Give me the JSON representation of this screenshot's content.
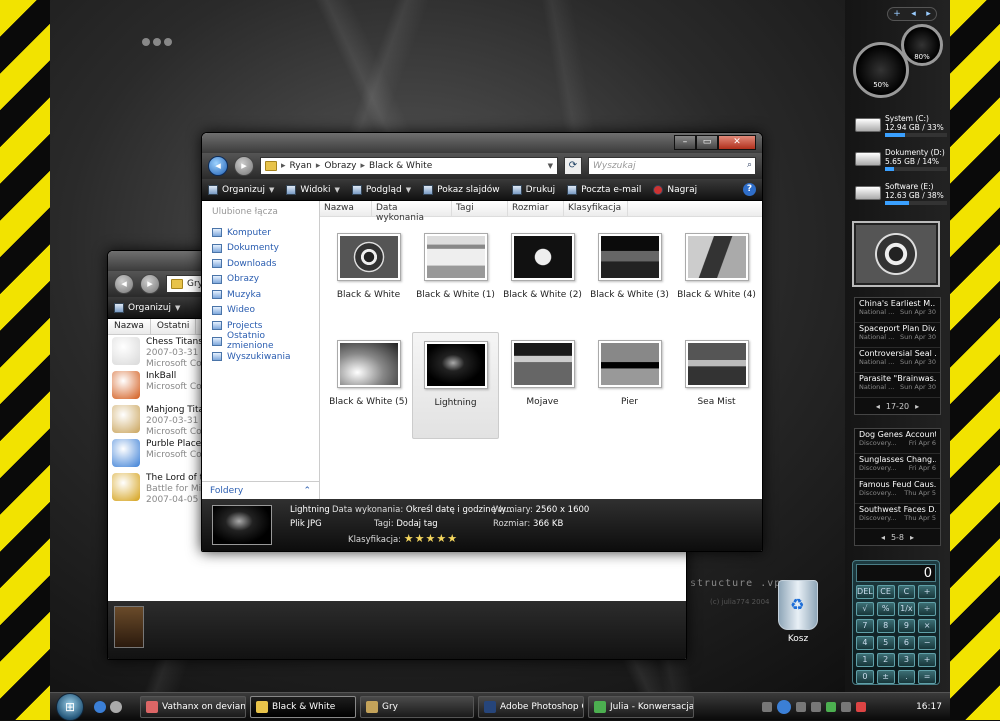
{
  "desktop": {
    "wallpaper_text": "structure .vps",
    "wallpaper_subtext": "(c) julia774 2004",
    "recycle_bin_label": "Kosz"
  },
  "front_window": {
    "title": "Black & White",
    "breadcrumb": [
      "Ryan",
      "Obrazy",
      "Black & White"
    ],
    "search_placeholder": "Wyszukaj",
    "toolbar": {
      "organize": "Organizuj",
      "views": "Widoki",
      "preview": "Podgląd",
      "slideshow": "Pokaz slajdów",
      "print": "Drukuj",
      "email": "Poczta e-mail",
      "burn": "Nagraj"
    },
    "nav_title": "Ulubione łącza",
    "nav_links": [
      "Komputer",
      "Dokumenty",
      "Downloads",
      "Obrazy",
      "Muzyka",
      "Wideo",
      "Projects",
      "Ostatnio zmienione",
      "Wyszukiwania"
    ],
    "folders_label": "Foldery",
    "columns": [
      "Nazwa",
      "Data wykonania",
      "Tagi",
      "Rozmiar",
      "Klasyfikacja"
    ],
    "files": [
      {
        "name": "Black & White",
        "art": "p1"
      },
      {
        "name": "Black & White (1)",
        "art": "p2"
      },
      {
        "name": "Black & White (2)",
        "art": "p3"
      },
      {
        "name": "Black & White (3)",
        "art": "p4"
      },
      {
        "name": "Black & White (4)",
        "art": "p5"
      },
      {
        "name": "Black & White (5)",
        "art": "p6"
      },
      {
        "name": "Lightning",
        "art": "p7"
      },
      {
        "name": "Mojave",
        "art": "p8"
      },
      {
        "name": "Pier",
        "art": "p9"
      },
      {
        "name": "Sea Mist",
        "art": "p10"
      }
    ],
    "selected_file": "Lightning",
    "details": {
      "name": "Lightning",
      "type": "Plik JPG",
      "date_label": "Data wykonania:",
      "date_value": "Określ datę i godzinę w...",
      "tags_label": "Tagi:",
      "tags_value": "Dodaj tag",
      "rating_label": "Klasyfikacja:",
      "rating_stars": "★★★★★",
      "dimensions_label": "Wymiary:",
      "dimensions_value": "2560 x 1600",
      "size_label": "Rozmiar:",
      "size_value": "366 KB"
    }
  },
  "back_window": {
    "title_fragment": "Gry",
    "toolbar_organize": "Organizuj",
    "columns": [
      "Nazwa",
      "Ostatni"
    ],
    "games": [
      {
        "line1": "Chess Titans",
        "line2": "2007-03-31 1",
        "line3": "Microsoft Co",
        "icon_color": "#d8d8d8"
      },
      {
        "line1": "InkBall",
        "line2": "Microsoft Co",
        "line3": "",
        "icon_color": "#d25a1a"
      },
      {
        "line1": "Mahjong Tita",
        "line2": "2007-03-31 1",
        "line3": "Microsoft Co",
        "icon_color": "#c9a35a"
      },
      {
        "line1": "Purble Place",
        "line2": "Microsoft Co",
        "line3": "",
        "icon_color": "#3b7fd6"
      },
      {
        "line1": "The Lord of t",
        "line2": "Battle for Mid",
        "line3": "2007-04-05 1",
        "icon_color": "#d4a017"
      }
    ]
  },
  "sidebar": {
    "top_controls": [
      "+",
      "◂",
      "▸"
    ],
    "cpu_gauge": "50%",
    "mem_gauge": "80%",
    "drives": [
      {
        "name": "System (C:)",
        "usage": "12.94 GB / 33%",
        "percent": 33
      },
      {
        "name": "Dokumenty (D:)",
        "usage": "5.65 GB / 14%",
        "percent": 14
      },
      {
        "name": "Software (E:)",
        "usage": "12.63 GB / 38%",
        "percent": 38
      }
    ],
    "feed1": {
      "items": [
        {
          "headline": "China's Earliest M...",
          "source": "National ...",
          "date": "Sun Apr 30"
        },
        {
          "headline": "Spaceport Plan Div...",
          "source": "National ...",
          "date": "Sun Apr 30"
        },
        {
          "headline": "Controversial Seal ...",
          "source": "National ...",
          "date": "Sun Apr 30"
        },
        {
          "headline": "Parasite \"Brainwas...",
          "source": "National ...",
          "date": "Sun Apr 30"
        }
      ],
      "pager": "17-20"
    },
    "feed2": {
      "items": [
        {
          "headline": "Dog Genes Account...",
          "source": "Discovery...",
          "date": "Fri Apr 6"
        },
        {
          "headline": "Sunglasses Chang...",
          "source": "Discovery...",
          "date": "Fri Apr 6"
        },
        {
          "headline": "Famous Feud Caus...",
          "source": "Discovery...",
          "date": "Thu Apr 5"
        },
        {
          "headline": "Southwest Faces D...",
          "source": "Discovery...",
          "date": "Thu Apr 5"
        }
      ],
      "pager": "5-8"
    },
    "calculator": {
      "display": "0",
      "keys": [
        "DEL",
        "CE",
        "C",
        "+",
        "√",
        "%",
        "1/x",
        "÷",
        "7",
        "8",
        "9",
        "×",
        "4",
        "5",
        "6",
        "−",
        "1",
        "2",
        "3",
        "+",
        "0",
        "±",
        ".",
        "="
      ]
    }
  },
  "taskbar": {
    "start_glyph": "⊞",
    "tasks": [
      {
        "label": "Vathanx on deviant...",
        "active": false,
        "color": "#d66"
      },
      {
        "label": "Black & White",
        "active": true,
        "color": "#e8c34a"
      },
      {
        "label": "Gry",
        "active": false,
        "color": "#c4a35a"
      },
      {
        "label": "Adobe Photoshop C...",
        "active": false,
        "color": "#26457a"
      },
      {
        "label": "Julia - Konwersacja",
        "active": false,
        "color": "#4caf50"
      }
    ],
    "clock": "16:17"
  }
}
